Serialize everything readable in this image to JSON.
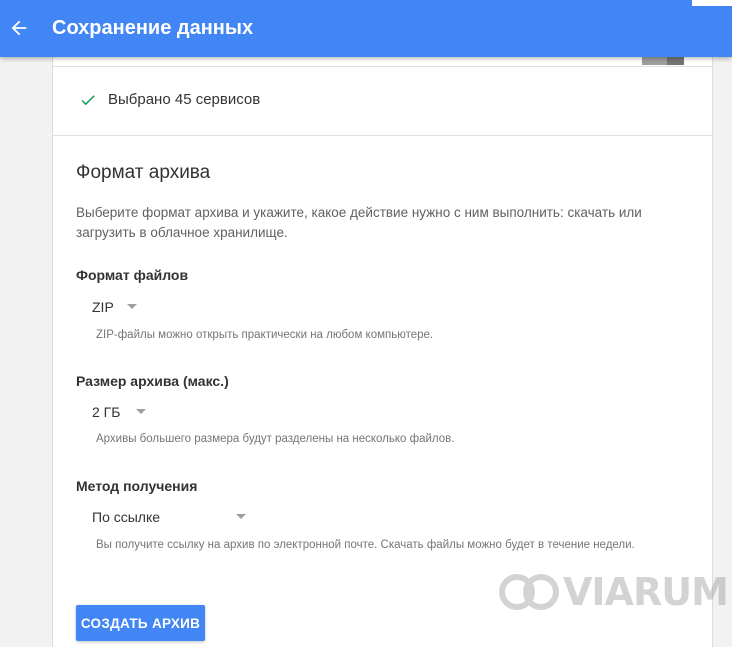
{
  "header": {
    "title": "Сохранение данных",
    "back_icon": "arrow-back-icon",
    "background_color": "#4285f4"
  },
  "selection": {
    "text": "Выбрано 45 сервисов",
    "icon": "check-icon",
    "icon_color": "#0f9d58"
  },
  "archive_format": {
    "title": "Формат архива",
    "description": "Выберите формат архива и укажите, какое действие нужно с ним выполнить: скачать или загрузить в облачное хранилище."
  },
  "fields": {
    "file_type": {
      "label": "Формат файлов",
      "value": "ZIP",
      "hint": "ZIP-файлы можно открыть практически на любом компьютере."
    },
    "archive_size": {
      "label": "Размер архива (макс.)",
      "value": "2 ГБ",
      "hint": "Архивы большего размера будут разделены на несколько файлов."
    },
    "delivery_method": {
      "label": "Метод получения",
      "value": "По ссылке",
      "hint": "Вы получите ссылку на архив по электронной почте. Скачать файлы можно будет в течение недели."
    }
  },
  "create_button": {
    "label": "СОЗДАТЬ АРХИВ",
    "color": "#4285f4"
  },
  "watermark": {
    "text": "VIARUM",
    "icon": "viarum-logo-icon"
  }
}
